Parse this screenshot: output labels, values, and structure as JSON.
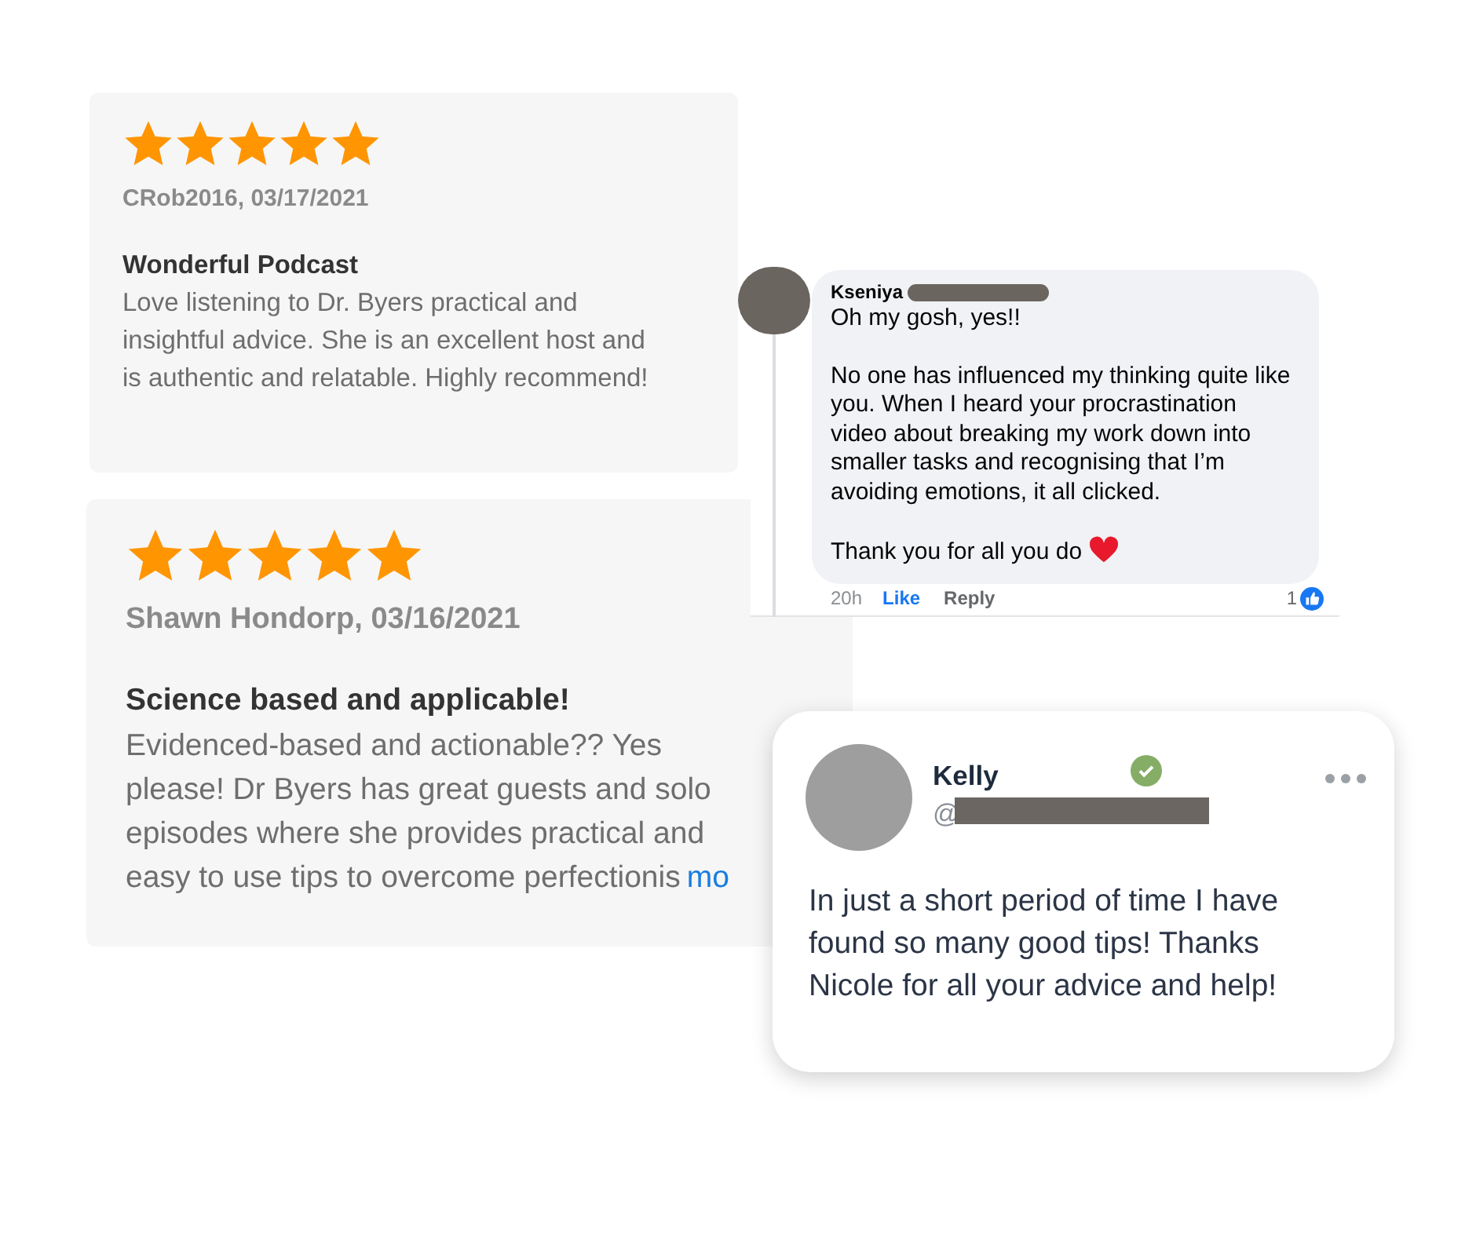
{
  "reviews": [
    {
      "stars": 5,
      "author": "CRob2016, 03/17/2021",
      "title": "Wonderful Podcast",
      "body": [
        "Love listening to Dr. Byers practical and",
        "insightful advice. She is an excellent host and",
        "is authentic and relatable. Highly recommend!"
      ]
    },
    {
      "stars": 5,
      "author": "Shawn Hondorp, 03/16/2021",
      "title": "Science based and applicable!",
      "body": [
        "Evidenced-based and actionable?? Yes",
        "please! Dr Byers has great guests and solo",
        "episodes where she provides practical and",
        "easy to use tips to overcome perfectionis"
      ],
      "more_link": "mo"
    }
  ],
  "comment": {
    "name": "Kseniya",
    "paragraphs": [
      "Oh my gosh, yes!!",
      "No one has influenced my thinking quite like you. When I heard your procrastination video about breaking my work down into smaller tasks and recognising that I’m avoiding emotions, it all clicked.",
      "Thank you for all you do"
    ],
    "time": "20h",
    "like": "Like",
    "reply": "Reply",
    "reaction_count": "1"
  },
  "post": {
    "name": "Kelly",
    "verified": true,
    "handle": "@",
    "text": "In just a short period of time I have found so many good tips! Thanks Nicole for all your advice and help!"
  }
}
